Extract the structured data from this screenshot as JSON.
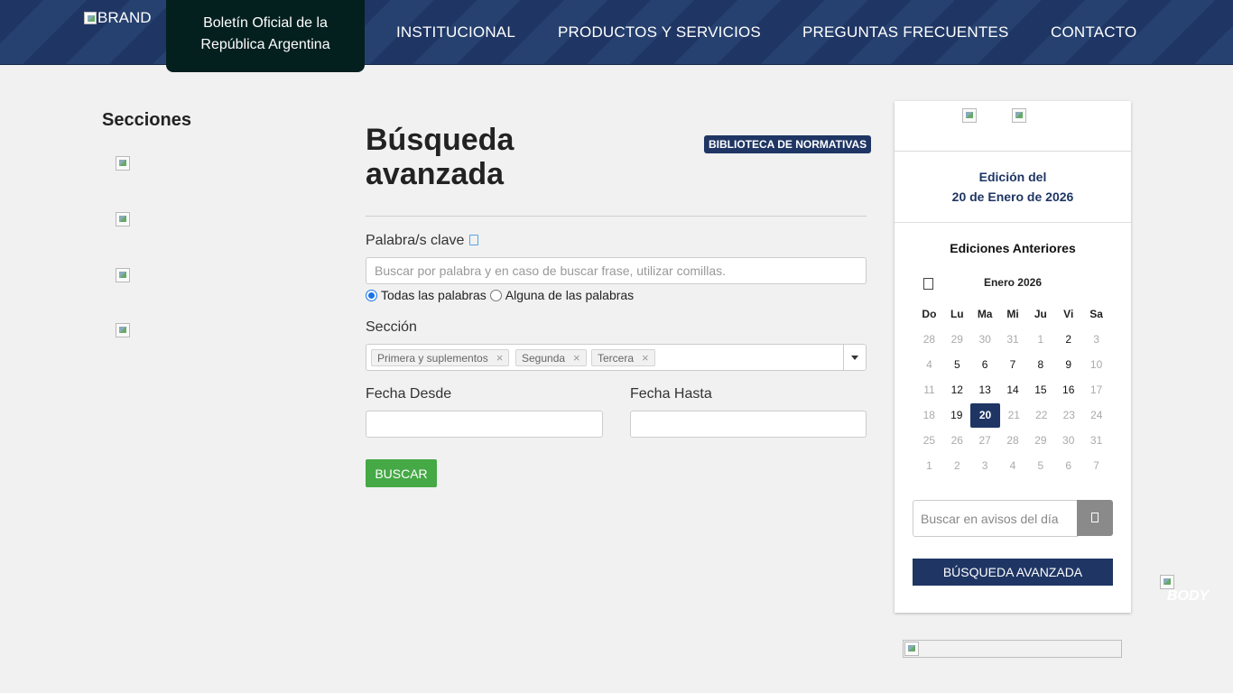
{
  "header": {
    "brand_alt": "BRAND",
    "site_name": "Boletín Oficial de la República Argentina",
    "nav": [
      "INSTITUCIONAL",
      "PRODUCTOS Y SERVICIOS",
      "PREGUNTAS FRECUENTES",
      "CONTACTO"
    ]
  },
  "sidebar": {
    "title": "Secciones"
  },
  "main": {
    "title": "Búsqueda avanzada",
    "biblioteca_button": "BIBLIOTECA DE NORMATIVAS",
    "keyword_label": "Palabra/s clave",
    "keyword_placeholder": "Buscar por palabra y en caso de buscar frase, utilizar comillas.",
    "radio_all": "Todas las palabras",
    "radio_any": "Alguna de las palabras",
    "section_label": "Sección",
    "section_chips": [
      "Primera y suplementos",
      "Segunda",
      "Tercera"
    ],
    "chip_remove": "×",
    "date_from_label": "Fecha Desde",
    "date_to_label": "Fecha Hasta",
    "search_button": "BUSCAR"
  },
  "panel": {
    "edition_line1": "Edición del",
    "edition_line2": "20 de Enero de 2026",
    "previous_editions": "Ediciones Anteriores",
    "calendar": {
      "month": "Enero 2026",
      "weekdays": [
        "Do",
        "Lu",
        "Ma",
        "Mi",
        "Ju",
        "Vi",
        "Sa"
      ],
      "weeks": [
        [
          "28",
          "29",
          "30",
          "31",
          "1",
          "2",
          "3"
        ],
        [
          "4",
          "5",
          "6",
          "7",
          "8",
          "9",
          "10"
        ],
        [
          "11",
          "12",
          "13",
          "14",
          "15",
          "16",
          "17"
        ],
        [
          "18",
          "19",
          "20",
          "21",
          "22",
          "23",
          "24"
        ],
        [
          "25",
          "26",
          "27",
          "28",
          "29",
          "30",
          "31"
        ],
        [
          "1",
          "2",
          "3",
          "4",
          "5",
          "6",
          "7"
        ]
      ],
      "muted": [
        [
          true,
          true,
          true,
          true,
          true,
          false,
          true
        ],
        [
          true,
          false,
          false,
          false,
          false,
          false,
          true
        ],
        [
          true,
          false,
          false,
          false,
          false,
          false,
          true
        ],
        [
          true,
          false,
          false,
          true,
          true,
          true,
          true
        ],
        [
          true,
          true,
          true,
          true,
          true,
          true,
          true
        ],
        [
          true,
          true,
          true,
          true,
          true,
          true,
          true
        ]
      ],
      "selected_day": "20"
    },
    "search_placeholder": "Buscar en avisos del día",
    "advanced_button": "BÚSQUEDA AVANZADA"
  },
  "footer_image_alt": "BODY",
  "colors": {
    "navy": "#1f3664",
    "green": "#45a946",
    "dark_tab": "#03201f"
  }
}
